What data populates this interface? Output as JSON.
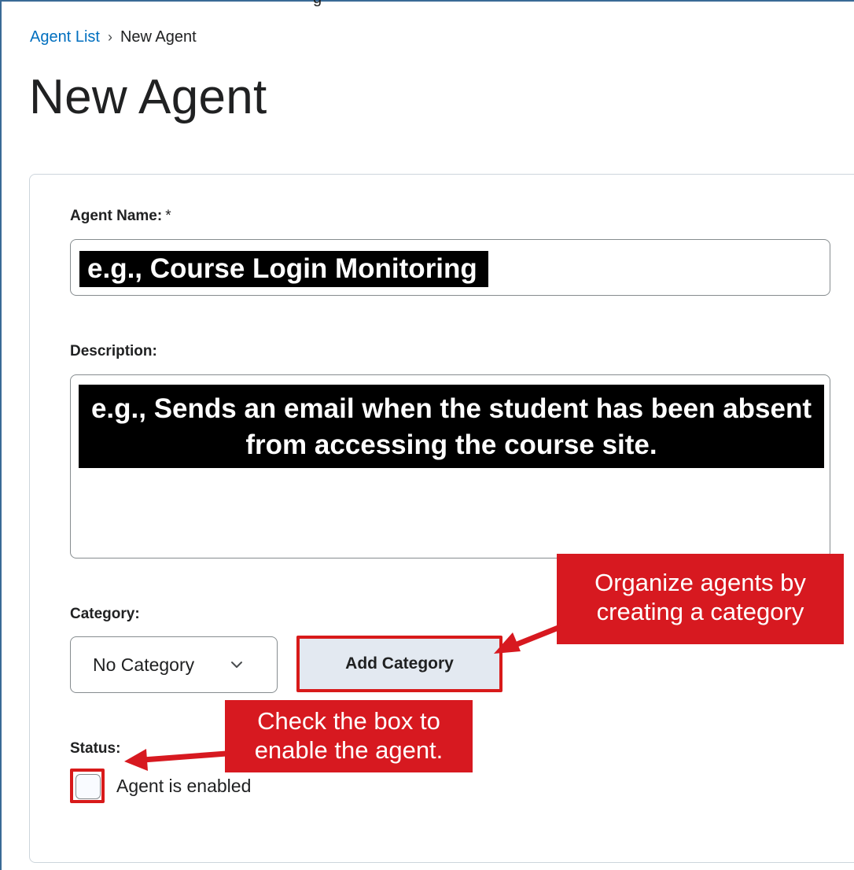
{
  "header": {
    "top_fragment": "g",
    "breadcrumb": {
      "parent": "Agent List",
      "separator": "›",
      "current": "New Agent"
    },
    "title": "New Agent"
  },
  "form": {
    "agent_name": {
      "label": "Agent Name:",
      "required_marker": "*",
      "placeholder": "e.g., Course Login Monitoring"
    },
    "description": {
      "label": "Description:",
      "placeholder": "e.g.,  Sends an email when the student has been absent from accessing the course site."
    },
    "category": {
      "label": "Category:",
      "selected": "No Category",
      "add_button": "Add Category"
    },
    "status": {
      "label": "Status:",
      "checkbox_label": "Agent is enabled",
      "checked": false
    }
  },
  "annotations": {
    "category_callout": "Organize agents by creating a category",
    "status_callout": "Check the box to enable the agent.",
    "color": "#d71920"
  },
  "colors": {
    "link": "#006fbf",
    "button_bg": "#e3e9f1",
    "annotation_red": "#d71920"
  }
}
